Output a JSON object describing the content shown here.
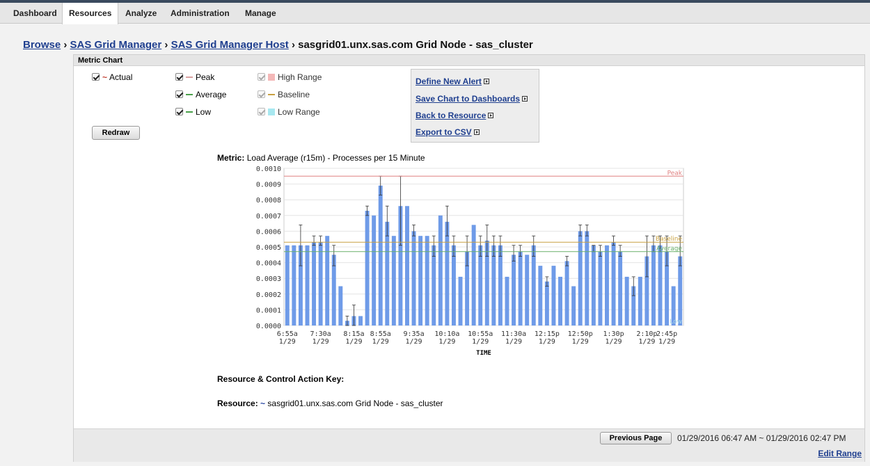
{
  "nav": {
    "tabs": [
      "Dashboard",
      "Resources",
      "Analyze",
      "Administration",
      "Manage"
    ],
    "active": "Resources"
  },
  "breadcrumb": {
    "items": [
      "Browse",
      "SAS Grid Manager",
      "SAS Grid Manager Host"
    ],
    "separator": "›",
    "current": "sasgrid01.unx.sas.com Grid Node - sas_cluster"
  },
  "panel": {
    "title": "Metric Chart"
  },
  "legend": {
    "actual": "Actual",
    "peak": "Peak",
    "average": "Average",
    "low": "Low",
    "high_range": "High Range",
    "baseline": "Baseline",
    "low_range": "Low Range",
    "colors": {
      "actual": "#c0392b",
      "peak": "#d9a0a0",
      "average": "#4aa04a",
      "low": "#4aa04a",
      "high_range": "#f4b8b8",
      "baseline": "#c8a040",
      "low_range": "#a8e8f0"
    }
  },
  "redraw_button": "Redraw",
  "actions": {
    "define_alert": "Define New Alert",
    "save_chart": "Save Chart to Dashboards",
    "back_resource": "Back to Resource",
    "export_csv": "Export to CSV"
  },
  "metric": {
    "label": "Metric:",
    "value": "Load Average (r15m) - Processes per 15 Minute"
  },
  "chart_data": {
    "type": "bar",
    "xlabel": "TIME",
    "ylabel": "",
    "ylim": [
      0,
      0.001
    ],
    "yticks": [
      "0.0010",
      "0.0009",
      "0.0008",
      "0.0007",
      "0.0006",
      "0.0005",
      "0.0004",
      "0.0003",
      "0.0002",
      "0.0001",
      "0.0000"
    ],
    "xticks": [
      {
        "t": "6:55a",
        "d": "1/29"
      },
      {
        "t": "7:30a",
        "d": "1/29"
      },
      {
        "t": "8:15a",
        "d": "1/29"
      },
      {
        "t": "8:55a",
        "d": "1/29"
      },
      {
        "t": "9:35a",
        "d": "1/29"
      },
      {
        "t": "10:10a",
        "d": "1/29"
      },
      {
        "t": "10:55a",
        "d": "1/29"
      },
      {
        "t": "11:30a",
        "d": "1/29"
      },
      {
        "t": "12:15p",
        "d": "1/29"
      },
      {
        "t": "12:50p",
        "d": "1/29"
      },
      {
        "t": "1:30p",
        "d": "1/29"
      },
      {
        "t": "2:10p",
        "d": "1/29"
      },
      {
        "t": "2:45p",
        "d": "1/29"
      }
    ],
    "xtick_bar_index": [
      0,
      5,
      10,
      14,
      19,
      24,
      29,
      34,
      39,
      44,
      49,
      54,
      57
    ],
    "values": [
      0.00051,
      0.00051,
      0.00051,
      0.00051,
      0.00053,
      0.00053,
      0.00057,
      0.00045,
      0.00025,
      3e-05,
      6e-05,
      6e-05,
      0.00073,
      0.0007,
      0.00089,
      0.00066,
      0.00057,
      0.00076,
      0.00076,
      0.0006,
      0.00057,
      0.00057,
      0.00051,
      0.0007,
      0.00066,
      0.00051,
      0.00031,
      0.00047,
      0.00064,
      0.00051,
      0.00054,
      0.00051,
      0.00051,
      0.00031,
      0.00045,
      0.00047,
      0.00045,
      0.00051,
      0.00038,
      0.00028,
      0.00038,
      0.00031,
      0.00041,
      0.00025,
      0.0006,
      0.0006,
      0.00051,
      0.00047,
      0.00051,
      0.00053,
      0.00047,
      0.00031,
      0.00025,
      0.00031,
      0.00044,
      0.00051,
      0.00051,
      0.00047,
      0.00025,
      0.00044
    ],
    "error_hi": [
      0,
      0,
      0.00064,
      0,
      0.00057,
      0.00057,
      0,
      0.00051,
      0,
      6e-05,
      0.00013,
      0,
      0.00076,
      0,
      0.00095,
      0.00076,
      0,
      0.00095,
      0,
      0.00064,
      0,
      0,
      0.00057,
      0,
      0.00076,
      0.00057,
      0,
      0.00057,
      0,
      0.00057,
      0.00064,
      0.00057,
      0.00057,
      0,
      0.00051,
      0.00051,
      0,
      0.00057,
      0,
      0.00031,
      0,
      0,
      0.00044,
      0,
      0.00064,
      0.00064,
      0.00051,
      0.00051,
      0,
      0.00057,
      0.00051,
      0,
      0.00031,
      0,
      0.00057,
      0.00057,
      0.00057,
      0.00057,
      0,
      0.00057
    ],
    "error_lo": [
      0,
      0,
      0.00038,
      0,
      0.00051,
      0.00051,
      0,
      0.00038,
      0,
      0.0,
      0.0,
      0,
      0.0007,
      0,
      0.00083,
      0.00057,
      0,
      0.00051,
      0,
      0.00057,
      0,
      0,
      0.00044,
      0,
      0.00057,
      0.00044,
      0,
      0.00038,
      0,
      0.00044,
      0.00044,
      0.00044,
      0.00044,
      0,
      0.00041,
      0.00044,
      0,
      0.00044,
      0,
      0.00025,
      0,
      0,
      0.00038,
      0,
      0.00057,
      0.00057,
      0.00047,
      0.00044,
      0,
      0.00051,
      0.00044,
      0,
      0.00019,
      0,
      0.00031,
      0.00047,
      0.00047,
      0.00038,
      0,
      0.00038
    ],
    "reference_lines": [
      {
        "name": "Peak",
        "value": 0.00095,
        "color": "#e08080"
      },
      {
        "name": "Baseline",
        "value": 0.00053,
        "color": "#c8a040"
      },
      {
        "name": "Average",
        "value": 0.00047,
        "color": "#6ab06a"
      },
      {
        "name": "Low",
        "value": 0.0,
        "color": "#a8d8e8"
      }
    ],
    "bar_color": "#6f9be8",
    "grid": true
  },
  "key": {
    "title": "Resource & Control Action Key:",
    "resource_label": "Resource:",
    "resource_value": "sasgrid01.unx.sas.com Grid Node - sas_cluster"
  },
  "footer": {
    "previous_page": "Previous Page",
    "range": "01/29/2016 06:47 AM  ~  01/29/2016 02:47 PM",
    "edit_range": "Edit Range"
  }
}
